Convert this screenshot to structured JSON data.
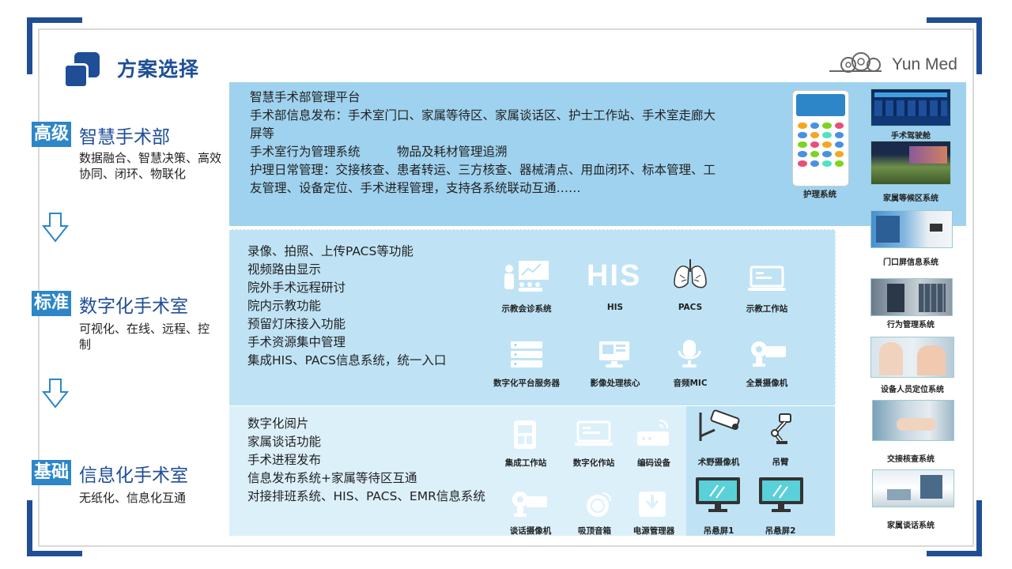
{
  "header": {
    "title": "方案选择",
    "logo_text": "Yun Med"
  },
  "levels": [
    {
      "tag": "高级",
      "title": "智慧手术部",
      "desc": "数据融合、智慧决策、高效协同、闭环、物联化"
    },
    {
      "tag": "标准",
      "title": "数字化手术室",
      "desc": "可视化、在线、远程、控制"
    },
    {
      "tag": "基础",
      "title": "信息化手术室",
      "desc": "无纸化、信息化互通"
    }
  ],
  "panel_top": {
    "lines": [
      "智慧手术部管理平台",
      "手术部信息发布：手术室门口、家属等待区、家属谈话区、护士工作站、手术室走廊大",
      "屏等",
      "手术室行为管理系统　　　物品及耗材管理追溯",
      "护理日常管理：交接核查、患者转运、三方核查、器械清点、用血闭环、标本管理、工",
      "友管理、设备定位、手术进程管理，支持各系统联动互通……"
    ],
    "phone_label": "护理系统"
  },
  "panel_mid": {
    "lines": [
      "录像、拍照、上传PACS等功能",
      "视频路由显示",
      "院外手术远程研讨",
      "院内示教功能",
      "预留灯床接入功能",
      "手术资源集中管理",
      "集成HIS、PACS信息系统，统一入口"
    ],
    "icons": [
      {
        "name": "teaching-consult-icon",
        "label": "示教会诊系统"
      },
      {
        "name": "his-icon",
        "label": "HIS",
        "text": "HIS"
      },
      {
        "name": "pacs-icon",
        "label": "PACS"
      },
      {
        "name": "teaching-workstation-icon",
        "label": "示教工作站"
      },
      {
        "name": "server-icon",
        "label": "数字化平台服务器"
      },
      {
        "name": "image-core-icon",
        "label": "影像处理核心"
      },
      {
        "name": "microphone-icon",
        "label": "音频MIC"
      },
      {
        "name": "panorama-camera-icon",
        "label": "全景摄像机"
      }
    ]
  },
  "panel_bot": {
    "lines": [
      "数字化阅片",
      "家属谈话功能",
      "手术进程发布",
      "信息发布系统+家属等待区互通",
      "对接排班系统、HIS、PACS、EMR信息系统"
    ],
    "icons": [
      {
        "name": "integrated-workstation-icon",
        "label": "集成工作站"
      },
      {
        "name": "digital-workstation-icon",
        "label": "数字化作站"
      },
      {
        "name": "encoder-icon",
        "label": "编码设备"
      },
      {
        "name": "talk-camera-icon",
        "label": "谈话摄像机"
      },
      {
        "name": "ceiling-speaker-icon",
        "label": "吸顶音箱"
      },
      {
        "name": "power-manager-icon",
        "label": "电源管理器"
      },
      {
        "name": "field-camera-icon",
        "label": "术野摄像机"
      },
      {
        "name": "boom-arm-icon",
        "label": "吊臂"
      },
      {
        "name": "hanging-screen-icon",
        "label": "吊悬屏1"
      },
      {
        "name": "hanging-screen-icon",
        "label": "吊悬屏2"
      }
    ]
  },
  "right_systems": [
    {
      "label": "手术驾驶舱"
    },
    {
      "label": "家属等候区系统"
    },
    {
      "label": "门口屏信息系统"
    },
    {
      "label": "行为管理系统"
    },
    {
      "label": "设备人员定位系统"
    },
    {
      "label": "交接核查系统"
    },
    {
      "label": "家属谈话系统"
    }
  ],
  "colors": {
    "brand": "#1f4e96",
    "tag": "#2d86c8",
    "panel_top": "#9fd2ee",
    "panel_mid": "#bfe3f5",
    "panel_bot": "#dcf0fa"
  }
}
